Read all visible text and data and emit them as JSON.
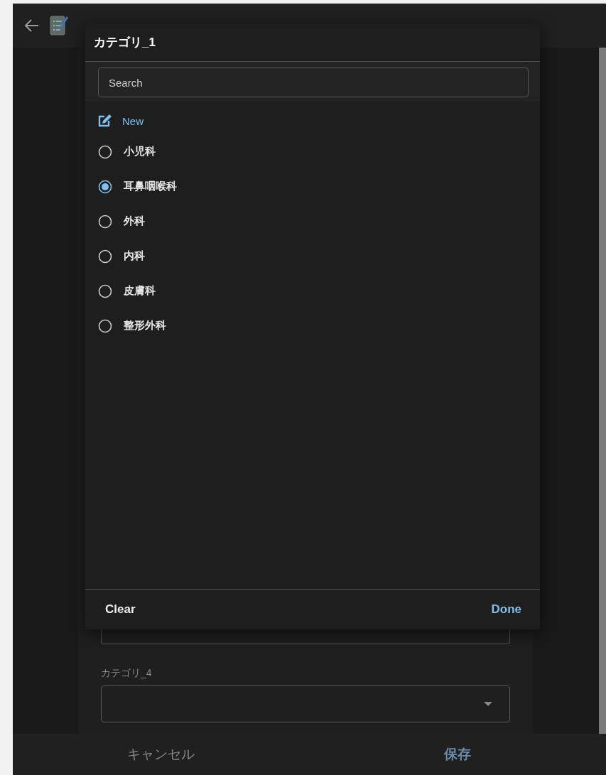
{
  "form": {
    "fields": [
      {
        "label": "カテゴリ_4",
        "kind": "select"
      }
    ]
  },
  "footer": {
    "cancel": "キャンセル",
    "save": "保存"
  },
  "dialog": {
    "title": "カテゴリ_1",
    "search": {
      "placeholder": "Search"
    },
    "new_label": "New",
    "options": [
      {
        "label": "小児科",
        "selected": false
      },
      {
        "label": "耳鼻咽喉科",
        "selected": true
      },
      {
        "label": "外科",
        "selected": false
      },
      {
        "label": "内科",
        "selected": false
      },
      {
        "label": "皮膚科",
        "selected": false
      },
      {
        "label": "整形外科",
        "selected": false
      }
    ],
    "clear": "Clear",
    "done": "Done"
  }
}
